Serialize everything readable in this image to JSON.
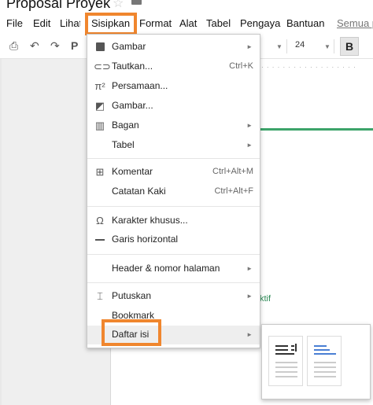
{
  "document": {
    "title": "Proposal Proyek"
  },
  "menubar": {
    "items": [
      "File",
      "Edit",
      "Lihat",
      "Sisipkan",
      "Format",
      "Alat",
      "Tabel",
      "Pengaya",
      "Bantuan"
    ],
    "link": "Semua p"
  },
  "toolbar": {
    "icons": [
      "print-icon",
      "undo-icon",
      "redo-icon",
      "paint-format-icon"
    ],
    "font_size": "24",
    "bold_label": "B"
  },
  "insert_menu": {
    "sections": [
      [
        {
          "label": "Gambar",
          "icon": "image-icon",
          "submenu": true
        },
        {
          "label": "Tautkan...",
          "icon": "link-icon",
          "shortcut": "Ctrl+K"
        },
        {
          "label": "Persamaan...",
          "icon": "equation-icon"
        },
        {
          "label": "Gambar...",
          "icon": "drawing-icon"
        },
        {
          "label": "Bagan",
          "icon": "chart-icon",
          "submenu": true
        },
        {
          "label": "Tabel",
          "submenu": true
        }
      ],
      [
        {
          "label": "Komentar",
          "icon": "add-comment-icon",
          "shortcut": "Ctrl+Alt+M"
        },
        {
          "label": "Catatan Kaki",
          "shortcut": "Ctrl+Alt+F"
        }
      ],
      [
        {
          "label": "Karakter khusus...",
          "icon": "omega-icon"
        },
        {
          "label": "Garis horizontal",
          "icon": "horizontal-line-icon"
        }
      ],
      [
        {
          "label": "Header & nomor halaman",
          "submenu": true
        }
      ],
      [
        {
          "label": "Putuskan",
          "icon": "page-break-icon",
          "submenu": true
        },
        {
          "label": "Bookmark"
        },
        {
          "label": "Daftar isi",
          "submenu": true,
          "active": true
        }
      ]
    ]
  },
  "doc_body": {
    "visible_text": "ktif"
  },
  "colors": {
    "highlight": "#f0862e",
    "green_rule": "#3ca36a",
    "toc_blue": "#4a7fd4"
  }
}
